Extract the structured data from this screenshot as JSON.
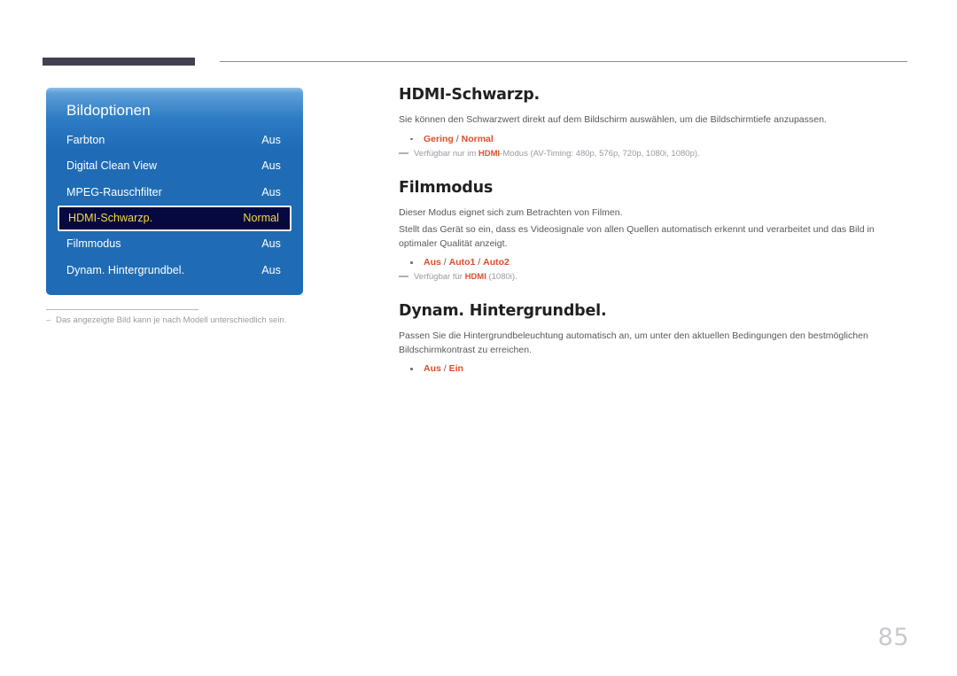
{
  "page": {
    "number": "85"
  },
  "osd": {
    "title": "Bildoptionen",
    "rows": [
      {
        "label": "Farbton",
        "value": "Aus",
        "selected": false
      },
      {
        "label": "Digital Clean View",
        "value": "Aus",
        "selected": false
      },
      {
        "label": "MPEG-Rauschfilter",
        "value": "Aus",
        "selected": false
      },
      {
        "label": "HDMI-Schwarzp.",
        "value": "Normal",
        "selected": true
      },
      {
        "label": "Filmmodus",
        "value": "Aus",
        "selected": false
      },
      {
        "label": "Dynam. Hintergrundbel.",
        "value": "Aus",
        "selected": false
      }
    ],
    "colors": {
      "panel_top": "#5e9fd8",
      "panel_bottom": "#1f6bb5",
      "selected_background": "#06093f",
      "selected_text": "#f5d93f",
      "selected_border": "#f2f2f2"
    }
  },
  "figure_note": {
    "dash": "–",
    "text": "Das angezeigte Bild kann je nach Modell unterschiedlich sein."
  },
  "sections": {
    "hdmi_black_level": {
      "title": "HDMI-Schwarzp.",
      "body": "Sie können den Schwarzwert direkt auf dem Bildschirm auswählen, um die Bildschirmtiefe anzupassen.",
      "option_parts": {
        "first": "Gering",
        "separator": " / ",
        "second": "Normal"
      },
      "note_prefix": "Verfügbar nur im ",
      "note_bold": "HDMI",
      "note_suffix": "-Modus (AV-Timing: 480p, 576p, 720p, 1080i, 1080p)."
    },
    "film_mode": {
      "title": "Filmmodus",
      "body1": "Dieser Modus eignet sich zum Betrachten von Filmen.",
      "body2": "Stellt das Gerät so ein, dass es Videosignale von allen Quellen automatisch erkennt und verarbeitet und das Bild in optimaler Qualität anzeigt.",
      "option_parts": {
        "first": "Aus",
        "sep1": " / ",
        "second": "Auto1",
        "sep2": " / ",
        "third": "Auto2"
      },
      "note_prefix": "Verfügbar für ",
      "note_bold": "HDMI",
      "note_suffix": " (1080i)."
    },
    "dynamic_backlight": {
      "title": "Dynam. Hintergrundbel.",
      "body": "Passen Sie die Hintergrundbeleuchtung automatisch an, um unter den aktuellen Bedingungen den bestmöglichen Bildschirmkontrast zu erreichen.",
      "option_parts": {
        "first": "Aus",
        "separator": " / ",
        "second": "Ein"
      }
    }
  },
  "colors": {
    "accent_orange": "#e04e29",
    "header_bar": "#454050",
    "body_text": "#58585d",
    "muted": "#9a9aa2"
  }
}
